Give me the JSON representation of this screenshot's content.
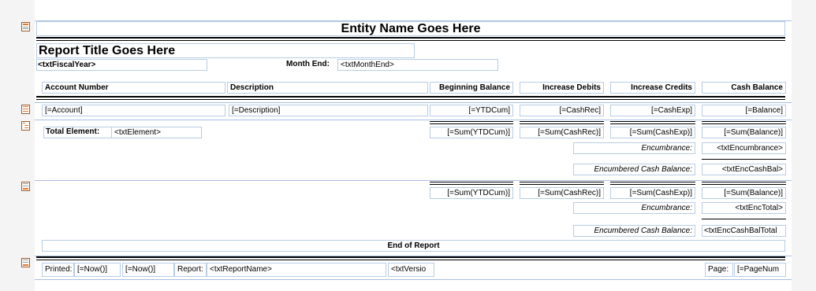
{
  "report": {
    "entity_name": "Entity Name Goes Here",
    "title": "Report Title Goes Here",
    "fiscal_year_field": "<txtFiscalYear>",
    "month_end_label": "Month End:",
    "month_end_field": "<txtMonthEnd>"
  },
  "columns": {
    "account_number": "Account Number",
    "description": "Description",
    "beginning_balance": "Beginning Balance",
    "increase_debits": "Increase Debits",
    "increase_credits": "Increase Credits",
    "cash_balance": "Cash Balance"
  },
  "detail": {
    "account": "[=Account]",
    "description": "[=Description]",
    "ytdcum": "[=YTDCum]",
    "cashrec": "[=CashRec]",
    "cashexp": "[=CashExp]",
    "balance": "[=Balance]"
  },
  "group_footer": {
    "total_element_label": "Total Element:",
    "element_field": "<txtElement>",
    "sum_ytdcum": "[=Sum(YTDCum)]",
    "sum_cashrec": "[=Sum(CashRec)]",
    "sum_cashexp": "[=Sum(CashExp)]",
    "sum_balance": "[=Sum(Balance)]",
    "encumbrance_label": "Encumbrance:",
    "encumbrance_field": "<txtEncumbrance>",
    "enc_cash_balance_label": "Encumbered Cash Balance:",
    "enc_cash_balance_field": "<txtEncCashBal>"
  },
  "report_footer": {
    "sum_ytdcum": "[=Sum(YTDCum)]",
    "sum_cashrec": "[=Sum(CashRec)]",
    "sum_cashexp": "[=Sum(CashExp)]",
    "sum_balance": "[=Sum(Balance)]",
    "encumbrance_label": "Encumbrance:",
    "enc_total_field": "<txtEncTotal>",
    "enc_cash_balance_label": "Encumbered Cash Balance:",
    "enc_cash_bal_total_field": "<txtEncCashBalTotal",
    "end_of_report": "End of Report"
  },
  "page_footer": {
    "printed_label": "Printed:",
    "now1": "[=Now()]",
    "now2": "[=Now()]",
    "report_label": "Report:",
    "report_name_field": "<txtReportName>",
    "version_field": "<txtVersio",
    "page_label": "Page:",
    "page_num_field": "[=PageNum"
  },
  "icons": [
    "report-header-icon",
    "detail-icon",
    "group-footer-icon",
    "report-footer-icon",
    "page-footer-icon"
  ],
  "colors": {
    "guide": "#a6bfe0",
    "field_border": "#b8cce4",
    "background": "#f4f4f4"
  }
}
